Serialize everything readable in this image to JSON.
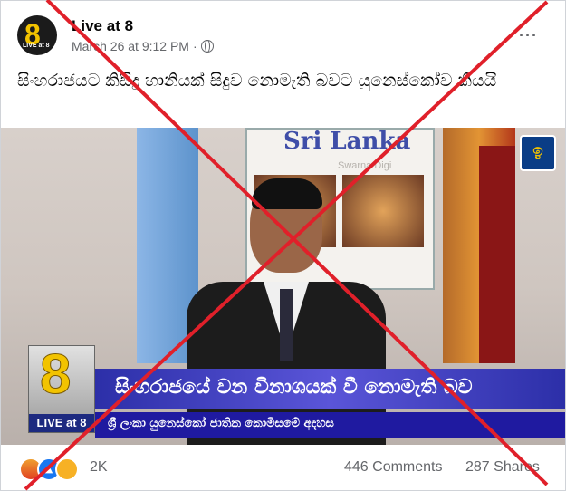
{
  "post": {
    "page_name": "Live at 8",
    "timestamp": "March 26 at 9:12 PM",
    "separator": "·",
    "audience_icon": "globe-icon",
    "more_label": "···",
    "caption": "සිංහරාජයට කිසිදු හානියක් සිදුව නොමැති බවට යුනෙස්කෝව කියයි",
    "avatar": {
      "logo_digit": "8",
      "logo_text": "LIVE at 8"
    }
  },
  "video": {
    "poster_title": "Sri Lanka",
    "watermark": "Swarna Digi",
    "channel_logo_text": "",
    "corner_logo": {
      "digit": "8",
      "label": "LIVE at 8"
    },
    "headline": "සිංහරාජයේ වන විනාශයක් වී නොමැති බව",
    "subheadline": "ශ්‍රී ලංකා යුනෙස්කෝ ජාතික කොමිසමේ අදහස"
  },
  "engagement": {
    "reactions": [
      "angry-icon",
      "like-icon",
      "wow-icon"
    ],
    "reaction_count": "2K",
    "comments": "446 Comments",
    "shares": "287 Shares"
  },
  "colors": {
    "overlay_x": "#e0202a",
    "band_primary": "#2c2fa8",
    "band_secondary": "#1f1aa0",
    "logo_gold": "#f2c300"
  }
}
